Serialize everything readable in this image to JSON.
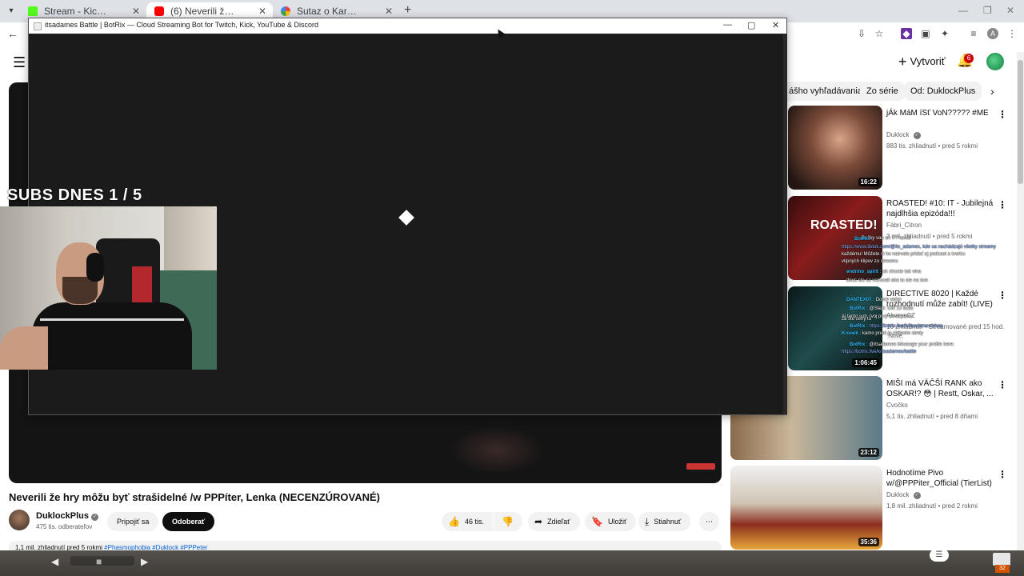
{
  "browser": {
    "tabs": [
      {
        "title": "Stream - Kick Dashboard",
        "color": "#53fc18",
        "active": false
      },
      {
        "title": "(6) Neverili že hry môžu byť str",
        "color": "#ff0000",
        "active": true
      },
      {
        "title": "Sutaz o Karambit Marble Fade",
        "color": "#ea4335",
        "active": false
      }
    ],
    "new_tab": "+",
    "profile_letter": "A"
  },
  "overlay_window": {
    "title": "itsadames Battle | BotRix — Cloud Streaming Bot for Twitch, Kick, YouTube & Discord"
  },
  "stream_overlay": {
    "subs_counter": "SUBS DNES 1 / 5",
    "chat": [
      {
        "user": "",
        "text": "Bečky van an YT kanál"
      },
      {
        "user": "BotRix :",
        "text": ""
      },
      {
        "user": "",
        "text": "https://www.tiktok.com/@its_adames, kde sa nachádzajú všetky streamy"
      },
      {
        "user": "",
        "text": "každému! Môžete si ho natrvalo pridať aj podcast a tvorbu"
      },
      {
        "user": "",
        "text": "vtipných klipov zo streamu"
      },
      {
        "user": "endrino_spirit :",
        "text": "ak chcete tak vlna"
      },
      {
        "user": "",
        "text": "dnes ste sa venovali ako to ste na tom"
      },
      {
        "user": "DANTEX07 :",
        "text": "Dobrý večer"
      },
      {
        "user": "BotRix :",
        "text": "@Stejk: Gift 10 subs"
      },
      {
        "user": "",
        "text": "Aj tento sub, tvoj prvý zo streamu"
      },
      {
        "user": "",
        "text": "za ste ceny tu"
      },
      {
        "user": "BotRix :",
        "text": "https://botrix.live/k/itsadames/shop"
      },
      {
        "user": "Krooek :",
        "text": "kamo pretó ja zhlienim strely"
      },
      {
        "user": "BotRix :",
        "text": "@itsadames Message your profile here:"
      },
      {
        "user": "",
        "text": "https://botrix.live/k/itsadames/battle"
      }
    ]
  },
  "youtube": {
    "create_label": "Vytvoriť",
    "notif_count": "6",
    "chips": [
      "ášho vyhľadávania",
      "Zo série",
      "Od: DuklockPlus"
    ],
    "video_title": "Neverili že hry môžu byť strašidelné /w PPPíter, Lenka (NECENZÚROVANÉ)",
    "channel_name": "DuklockPlus",
    "channel_subs": "475 tis. odberateľov",
    "join_label": "Pripojiť sa",
    "subscribe_label": "Odoberať",
    "likes": "46 tis.",
    "share_label": "Zdieľať",
    "save_label": "Uložiť",
    "download_label": "Stiahnuť",
    "desc_meta": "1,1 mil. zhliadnutí  pred 5 rokmi",
    "desc_tags": "#Phasmophobia #Duklock #PPPeter",
    "recommended": [
      {
        "title": "jÁk MáM íSť VoN????? #ME",
        "channel": "Duklock",
        "meta": "883 tis. zhliadnutí • pred 5 rokmi",
        "duration": "16:22",
        "new": ""
      },
      {
        "title": "ROASTED! #10: IT - Jubilejná najdlhšia epizóda!!!",
        "channel": "Fábri_Citron",
        "meta": "3 mil. zhliadnutí • pred 5 rokmi",
        "duration": "",
        "new": ""
      },
      {
        "title": "DIRECTIVE 8020 | Každé rozhodnutí může zabít! (LIVE)",
        "channel": "AlwaysCZ",
        "meta": "16 zhliadnutí • Streamované pred 15 hod.",
        "duration": "1:06:45",
        "new": "Nové"
      },
      {
        "title": "MIŠI má VÄČŠÍ RANK ako OSKAR!? 😳 | Restt, Oskar, ...",
        "channel": "Cvočko",
        "meta": "5,1 tis. zhliadnutí • pred 8 dňami",
        "duration": "23:12",
        "new": ""
      },
      {
        "title": "Hodnotíme Pivo w/@PPPiter_Official (TierList)",
        "channel": "Duklock",
        "meta": "1,8 mil. zhliadnutí • pred 2 rokmi",
        "duration": "35:36",
        "new": ""
      }
    ]
  },
  "taskbar": {
    "tray_count": "32"
  }
}
